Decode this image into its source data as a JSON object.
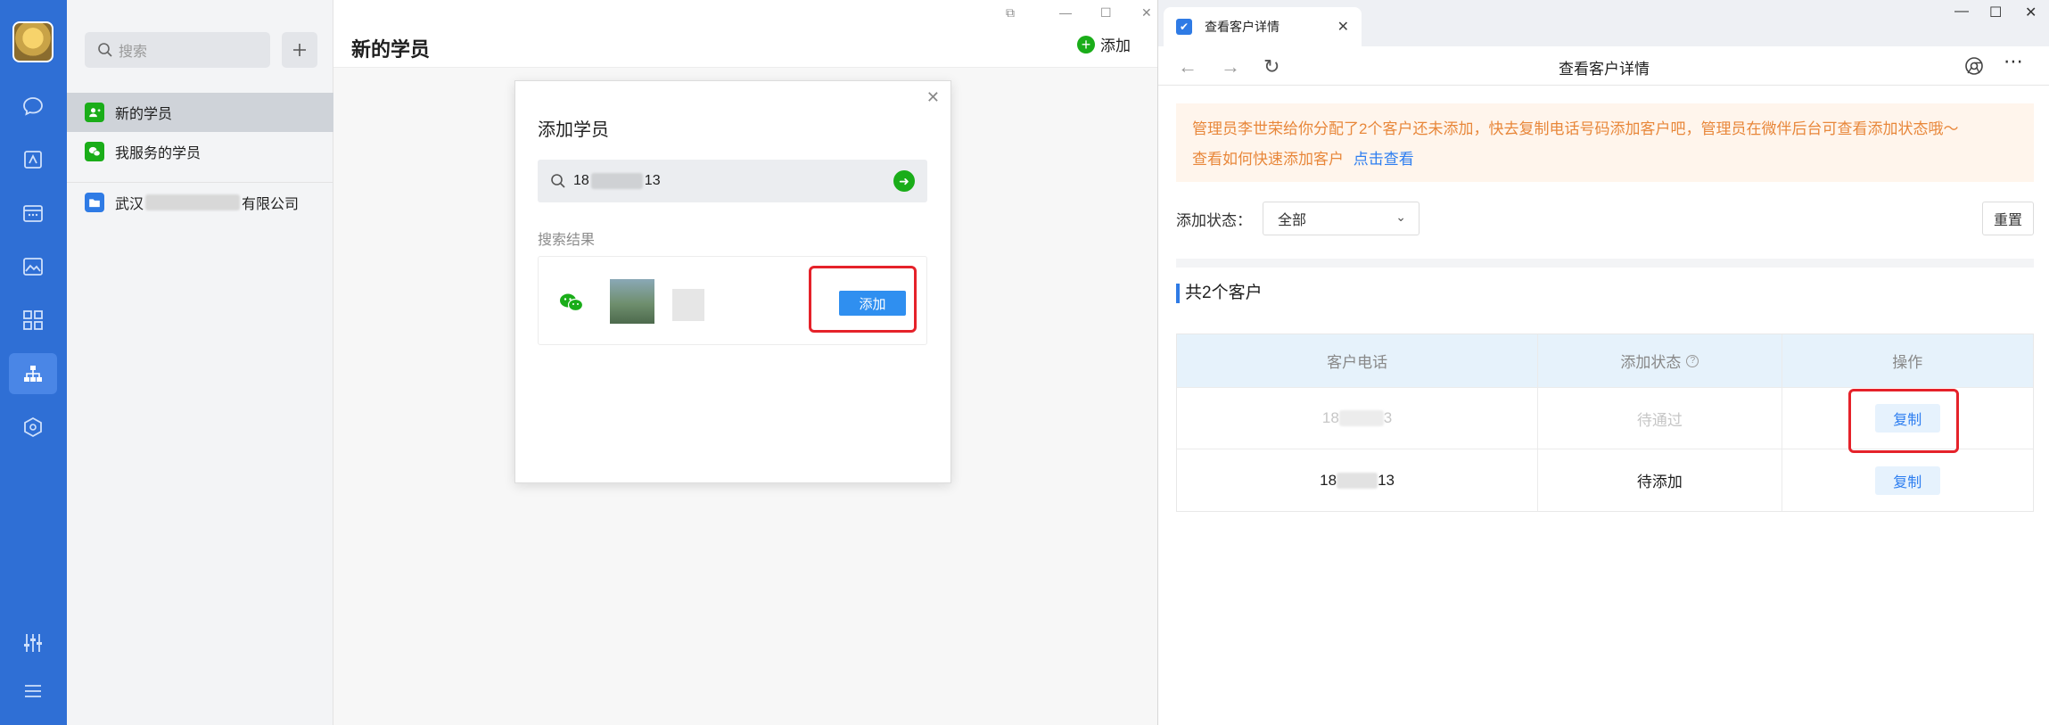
{
  "rail": {
    "icons": [
      "chat-icon",
      "workbench-icon",
      "calendar-icon",
      "photos-icon",
      "apps-icon",
      "org-contacts-icon",
      "cube-icon",
      "settings-sliders-icon",
      "menu-icon"
    ]
  },
  "contacts": {
    "search_placeholder": "搜索",
    "items": [
      {
        "label": "新的学员",
        "icon": "new-student-icon",
        "color": "#1aad19"
      },
      {
        "label": "我服务的学员",
        "icon": "wechat-icon",
        "color": "#1aad19"
      },
      {
        "label_prefix": "武汉",
        "label_suffix": "有限公司",
        "icon": "folder-icon",
        "color": "#2f7be5"
      }
    ]
  },
  "main": {
    "title": "新的学员",
    "add_label": "添加"
  },
  "dialog": {
    "title": "添加学员",
    "search_prefix": "18",
    "search_suffix": "13",
    "results_label": "搜索结果",
    "add_button": "添加"
  },
  "browser": {
    "tab_title": "查看客户详情",
    "page_title": "查看客户详情",
    "notice_line1": "管理员李世荣给你分配了2个客户还未添加，快去复制电话号码添加客户吧，管理员在微伴后台可查看添加状态哦～",
    "notice_line2": "查看如何快速添加客户",
    "notice_link": "点击查看",
    "filter_label": "添加状态：",
    "filter_value": "全部",
    "reset_label": "重置",
    "total_label": "共2个客户",
    "columns": [
      "客户电话",
      "添加状态",
      "操作"
    ],
    "rows": [
      {
        "phone_prefix": "18",
        "phone_suffix": "3",
        "status": "待通过",
        "action": "复制"
      },
      {
        "phone_prefix": "18",
        "phone_suffix": "13",
        "status": "待添加",
        "action": "复制"
      }
    ]
  }
}
